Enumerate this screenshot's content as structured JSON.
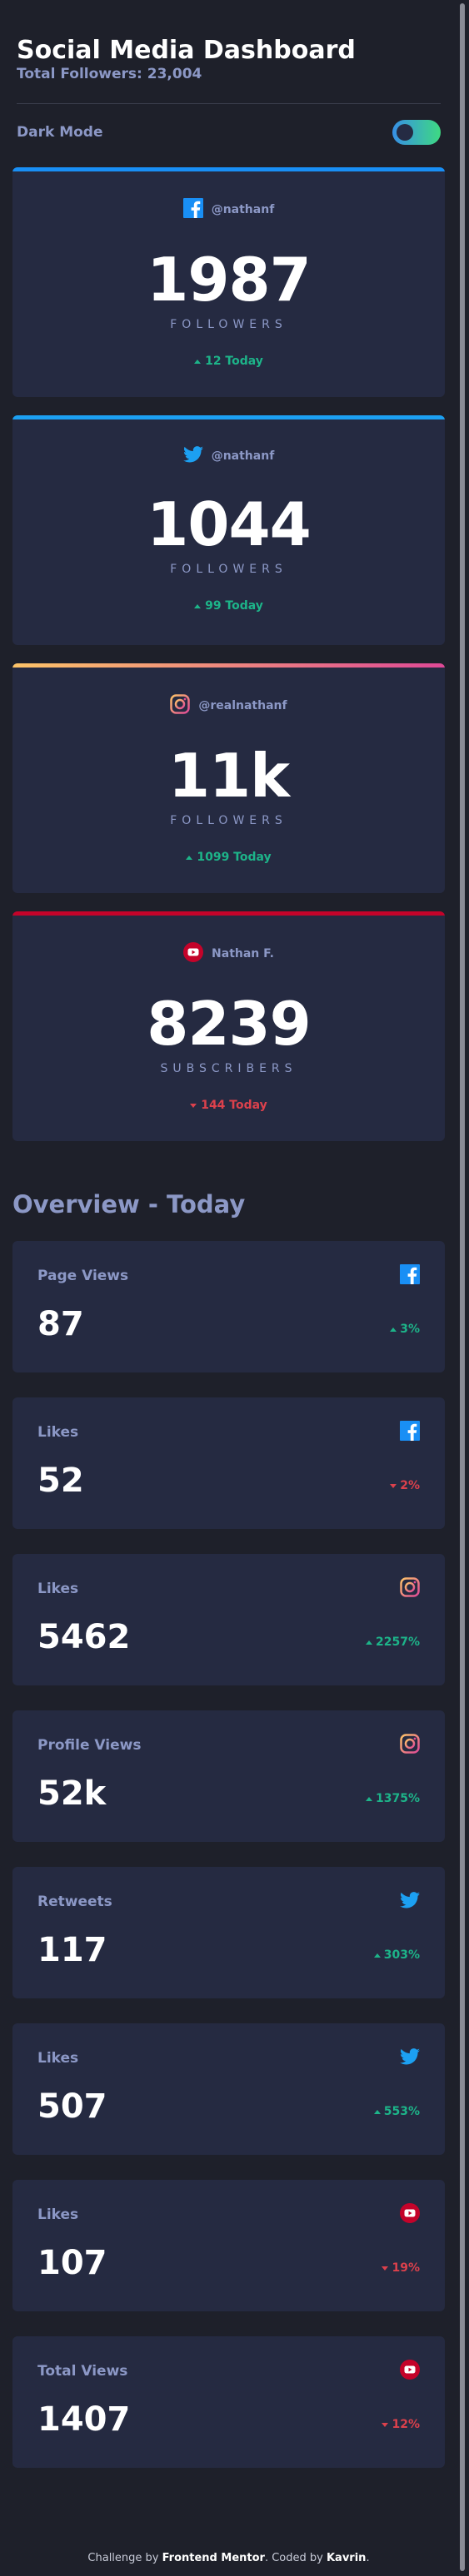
{
  "header": {
    "title": "Social Media Dashboard",
    "subtitle": "Total Followers: 23,004"
  },
  "mode": {
    "label": "Dark Mode"
  },
  "colors": {
    "facebook": "#198ff5",
    "twitter": "#1ca0f2",
    "instagram_start": "#fdc468",
    "instagram_end": "#df4996",
    "youtube": "#c4032a",
    "up": "#1db489",
    "down": "#dc414c"
  },
  "followers": [
    {
      "platform": "facebook",
      "icon": "facebook-icon",
      "handle": "@nathanf",
      "count": "1987",
      "label": "FOLLOWERS",
      "today": "12 Today",
      "trend": "up"
    },
    {
      "platform": "twitter",
      "icon": "twitter-icon",
      "handle": "@nathanf",
      "count": "1044",
      "label": "FOLLOWERS",
      "today": "99 Today",
      "trend": "up"
    },
    {
      "platform": "instagram",
      "icon": "instagram-icon",
      "handle": "@realnathanf",
      "count": "11k",
      "label": "FOLLOWERS",
      "today": "1099 Today",
      "trend": "up"
    },
    {
      "platform": "youtube",
      "icon": "youtube-icon",
      "handle": "Nathan F.",
      "count": "8239",
      "label": "SUBSCRIBERS",
      "today": "144 Today",
      "trend": "down"
    }
  ],
  "overview": {
    "title": "Overview - Today",
    "cards": [
      {
        "label": "Page Views",
        "platform": "facebook",
        "icon": "facebook-icon",
        "value": "87",
        "pct": "3%",
        "trend": "up"
      },
      {
        "label": "Likes",
        "platform": "facebook",
        "icon": "facebook-icon",
        "value": "52",
        "pct": "2%",
        "trend": "down"
      },
      {
        "label": "Likes",
        "platform": "instagram",
        "icon": "instagram-icon",
        "value": "5462",
        "pct": "2257%",
        "trend": "up"
      },
      {
        "label": "Profile Views",
        "platform": "instagram",
        "icon": "instagram-icon",
        "value": "52k",
        "pct": "1375%",
        "trend": "up"
      },
      {
        "label": "Retweets",
        "platform": "twitter",
        "icon": "twitter-icon",
        "value": "117",
        "pct": "303%",
        "trend": "up"
      },
      {
        "label": "Likes",
        "platform": "twitter",
        "icon": "twitter-icon",
        "value": "507",
        "pct": "553%",
        "trend": "up"
      },
      {
        "label": "Likes",
        "platform": "youtube",
        "icon": "youtube-icon",
        "value": "107",
        "pct": "19%",
        "trend": "down"
      },
      {
        "label": "Total Views",
        "platform": "youtube",
        "icon": "youtube-icon",
        "value": "1407",
        "pct": "12%",
        "trend": "down"
      }
    ]
  },
  "footer": {
    "prefix": "Challenge by",
    "brand": "Frontend Mentor",
    "middle": ". Coded by",
    "author": "Kavrin",
    "suffix": "."
  }
}
